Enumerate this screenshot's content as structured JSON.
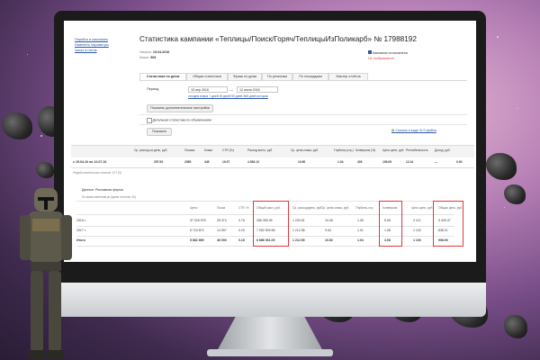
{
  "page": {
    "title_prefix": "Статистика кампании",
    "campaign_name": "«Теплицы/Поиск/Горяч/ТеплицыИзПоликарб»",
    "campaign_number": "№ 17988192"
  },
  "left_links": [
    "Перейти в кампанию",
    "Изменить параметры",
    "Заказ отчетов"
  ],
  "meta": {
    "start_label": "Начало:",
    "start_value": "15.04.2016",
    "clicks_label": "Клики:",
    "clicks_value": "508"
  },
  "right_status": {
    "stopped": "Кампания остановлена",
    "disabled": "Не отображается"
  },
  "tabs": [
    "Статистика по дням",
    "Общая статистика",
    "Фразы по дням",
    "По регионам",
    "По площадкам",
    "Мастер отчётов"
  ],
  "period": {
    "label": "Период",
    "from": "15 апр 2016",
    "to": "12 июля 2016",
    "presets": "сегодня вчера 7 дней 30 дней 90 дней 365 дней история"
  },
  "buttons": {
    "extra_settings": "Показать дополнительные настройки",
    "show": "Показать"
  },
  "checkbox_label": "Детальная статистика по объявлениям",
  "xls_link": "Скачать в виде XLS-файла",
  "summary": {
    "headers": [
      "Ср. расход за день, руб.",
      "Показы",
      "Клики",
      "CTR (%)",
      "Расход всего, руб.",
      "Ср. цена клика, руб.",
      "Глубина (стр.)",
      "Конверсия (%)",
      "Цена цели, руб.",
      "Рентабельность",
      "Доход, руб."
    ],
    "period_text": "с 15.04.16 по 12.07.16",
    "values": [
      "257.53",
      "2355",
      "445",
      "19.07",
      "4 893.10",
      "10.90",
      "1.04",
      "403",
      "109.09",
      "12.14",
      "—",
      "0.00"
    ],
    "footnote": "Недействительных кликов: 107 (9)"
  },
  "report": {
    "title": "Данные: Рекламная фирма",
    "subtitle": "По всем клиентам (в группе отчетов: 20)",
    "headers": [
      "Цены",
      "Показ",
      "CTR, %",
      "Общий расх, руб.",
      "Ср. расход/день, руб.",
      "Ср. цена клика, руб.",
      "Глубина, стр.",
      "Конверсия",
      "Цена цели, руб.",
      "Общая цель, руб."
    ],
    "rows": [
      {
        "label": "2016 г.",
        "cells": [
          "37 025 975",
          "28 374",
          "0.76",
          "285 359.35",
          "1 200.51",
          "10.06",
          "1.05",
          "5.06",
          "2 112",
          "3 425.37"
        ]
      },
      {
        "label": "2017 г.",
        "cells": [
          "5 724 874",
          "14 997",
          "0.20",
          "7 052 509.98",
          "1 212.58",
          "9.64",
          "1.01",
          "1.08",
          "1 102",
          "838.21"
        ]
      },
      {
        "label": "Итого",
        "cells": [
          "5 862 859",
          "46 000",
          "0.16",
          "6 886 931.09",
          "1 212.50",
          "10.52",
          "1.04",
          "3.08",
          "1 103",
          "908.90"
        ]
      }
    ]
  },
  "colors": {
    "highlight": "#e2373b",
    "link": "#2a57a6",
    "accent": "#e2373b"
  }
}
